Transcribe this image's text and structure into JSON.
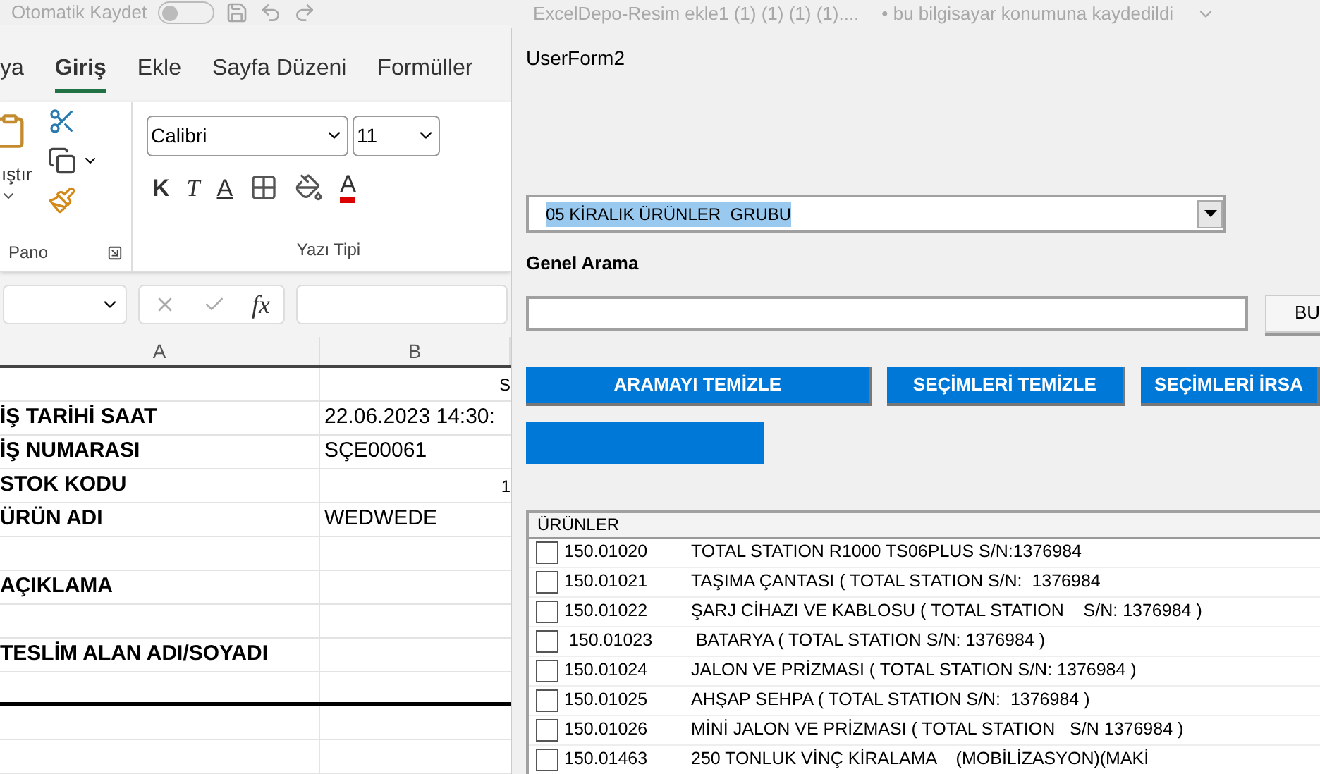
{
  "title_bar": {
    "autosave_label": "Otomatik Kaydet",
    "autosave_on": false,
    "document_title": "ExcelDepo-Resim ekle1 (1) (1) (1) (1)....",
    "save_status": "• bu bilgisayar konumuna kaydedildi"
  },
  "ribbon_tabs": [
    {
      "label": "ya",
      "selected": false
    },
    {
      "label": "Giriş",
      "selected": true
    },
    {
      "label": "Ekle",
      "selected": false
    },
    {
      "label": "Sayfa Düzeni",
      "selected": false
    },
    {
      "label": "Formüller",
      "selected": false
    }
  ],
  "clipboard_group": {
    "paste_label": "ıştır",
    "group_label": "Pano"
  },
  "font_group": {
    "font_name": "Calibri",
    "font_size": "11",
    "bold_label": "K",
    "italic_label": "T",
    "underline_label": "A",
    "font_color_label": "A",
    "group_label": "Yazı Tipi"
  },
  "formula_bar": {
    "fx_label": "fx"
  },
  "sheet": {
    "columns": [
      "A",
      "B"
    ],
    "rows": [
      {
        "label": "",
        "value": "",
        "edge": "S"
      },
      {
        "label": "İŞ TARİHİ SAAT",
        "value": "22.06.2023 14:30:",
        "edge": ""
      },
      {
        "label": "İŞ NUMARASI",
        "value": "SÇE00061",
        "edge": ""
      },
      {
        "label": "STOK KODU",
        "value": "",
        "edge": "1"
      },
      {
        "label": "ÜRÜN ADI",
        "value": "WEDWEDE",
        "edge": ""
      },
      {
        "label": "",
        "value": "",
        "edge": ""
      },
      {
        "label": "AÇIKLAMA",
        "value": "",
        "edge": ""
      },
      {
        "label": "",
        "value": "",
        "edge": ""
      },
      {
        "label": "TESLİM ALAN ADI/SOYADI",
        "value": "",
        "edge": ""
      },
      {
        "label": "",
        "value": "",
        "edge": ""
      },
      {
        "label": "",
        "value": "",
        "edge": ""
      },
      {
        "label": "",
        "value": "",
        "edge": ""
      }
    ]
  },
  "userform": {
    "title": "UserForm2",
    "group_combo": {
      "value": "05 KİRALIK ÜRÜNLER  GRUBU",
      "text_selected": true
    },
    "search_label": "Genel Arama",
    "search_button": "BU",
    "buttons": [
      "ARAMAYI TEMİZLE",
      "SEÇİMLERİ TEMİZLE",
      "SEÇİMLERİ İRSA"
    ],
    "list_header": "ÜRÜNLER",
    "products": [
      {
        "code": "150.01020",
        "name": "TOTAL STATION R1000 TS06PLUS S/N:1376984",
        "checked": false
      },
      {
        "code": "150.01021",
        "name": "TAŞIMA ÇANTASI ( TOTAL STATION S/N:  1376984",
        "checked": false
      },
      {
        "code": "150.01022",
        "name": "ŞARJ CİHAZI VE KABLOSU ( TOTAL STATION    S/N: 1376984 )",
        "checked": false
      },
      {
        "code": " 150.01023",
        "name": " BATARYA ( TOTAL STATION S/N: 1376984 )",
        "checked": false
      },
      {
        "code": "150.01024",
        "name": "JALON VE PRİZMASI ( TOTAL STATION S/N: 1376984 )",
        "checked": false
      },
      {
        "code": "150.01025",
        "name": "AHŞAP SEHPA ( TOTAL STATION S/N:  1376984 )",
        "checked": false
      },
      {
        "code": "150.01026",
        "name": "MİNİ JALON VE PRİZMASI ( TOTAL STATION   S/N 1376984 )",
        "checked": false
      },
      {
        "code": "150.01463",
        "name": "250 TONLUK VİNÇ KİRALAMA    (MOBİLİZASYON)(MAKİ",
        "checked": false
      }
    ]
  }
}
